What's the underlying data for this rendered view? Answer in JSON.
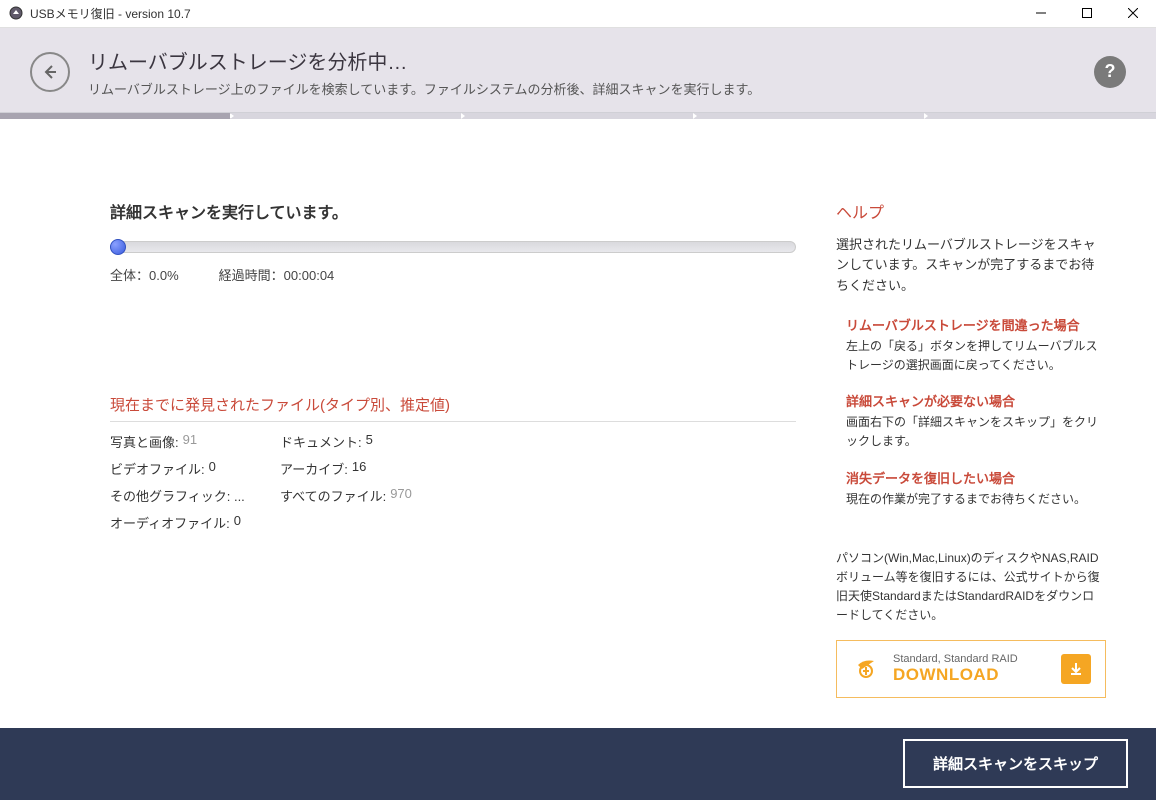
{
  "window": {
    "title": "USBメモリ復旧 - version 10.7"
  },
  "header": {
    "title": "リムーバブルストレージを分析中…",
    "subtitle": "リムーバブルストレージ上のファイルを検索しています。ファイルシステムの分析後、詳細スキャンを実行します。"
  },
  "scan": {
    "title": "詳細スキャンを実行しています。",
    "overall_label": "全体：",
    "overall_value": "0.0%",
    "elapsed_label": "経過時間：",
    "elapsed_value": "00:00:04"
  },
  "files": {
    "title": "現在までに発見されたファイル(タイプ別、推定値)",
    "rows": {
      "photos_label": "写真と画像:",
      "photos_value": "91",
      "docs_label": "ドキュメント:",
      "docs_value": "5",
      "video_label": "ビデオファイル:",
      "video_value": "0",
      "archive_label": "アーカイブ:",
      "archive_value": "16",
      "other_label": "その他グラフィック: ...",
      "all_label": "すべてのファイル:",
      "all_value": "970",
      "audio_label": "オーディオファイル:",
      "audio_value": "0"
    }
  },
  "help": {
    "title": "ヘルプ",
    "intro": "選択されたリムーバブルストレージをスキャンしています。スキャンが完了するまでお待ちください。",
    "sec1_title": "リムーバブルストレージを間違った場合",
    "sec1_body": "左上の「戻る」ボタンを押してリムーバブルストレージの選択画面に戻ってください。",
    "sec2_title": "詳細スキャンが必要ない場合",
    "sec2_body": "画面右下の「詳細スキャンをスキップ」をクリックします。",
    "sec3_title": "消失データを復旧したい場合",
    "sec3_body": "現在の作業が完了するまでお待ちください。",
    "promo": "パソコン(Win,Mac,Linux)のディスクやNAS,RAIDボリューム等を復旧するには、公式サイトから復旧天使StandardまたはStandardRAIDをダウンロードしてください。"
  },
  "download": {
    "top": "Standard, Standard RAID",
    "main": "DOWNLOAD"
  },
  "footer": {
    "skip": "詳細スキャンをスキップ"
  }
}
